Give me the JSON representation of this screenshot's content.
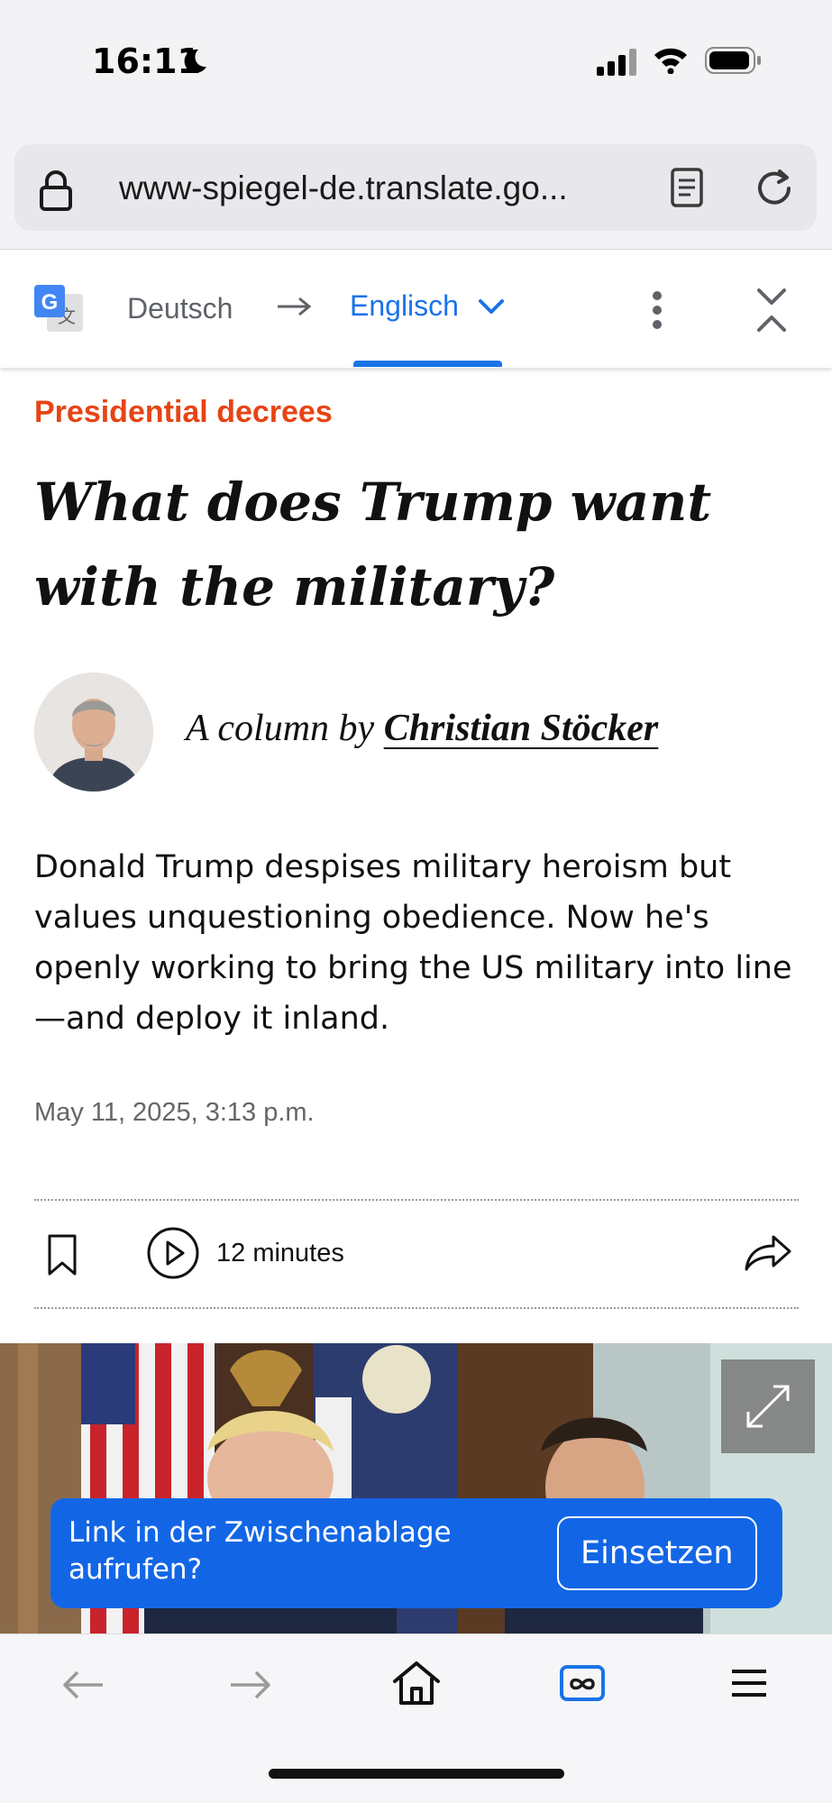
{
  "status_bar": {
    "time": "16:11"
  },
  "browser": {
    "url": "www-spiegel-de.translate.go...",
    "icons": [
      "lock-icon",
      "reader-icon",
      "reload-icon"
    ]
  },
  "translate_bar": {
    "source_language": "Deutsch",
    "target_language": "Englisch",
    "accent_color": "#1a73e8"
  },
  "article": {
    "kicker": "Presidential decrees",
    "kicker_color": "#e64415",
    "headline": "What does Trump want with the military?",
    "byline_prefix": "A column by",
    "author": "Christian Stöcker",
    "teaser": "Donald Trump despises military heroism but values unquestioning obedience. Now he's openly working to bring the US military into line—and deploy it inland.",
    "timestamp": "May 11, 2025, 3:13 p.m.",
    "audio_duration": "12 minutes"
  },
  "clipboard_toast": {
    "message": "Link in der Zwischenablage aufrufen?",
    "action_label": "Einsetzen",
    "color": "#1266e6"
  },
  "bottom_toolbar": {
    "icons": [
      "back-icon",
      "forward-icon",
      "home-icon",
      "tabs-icon",
      "menu-icon"
    ]
  }
}
